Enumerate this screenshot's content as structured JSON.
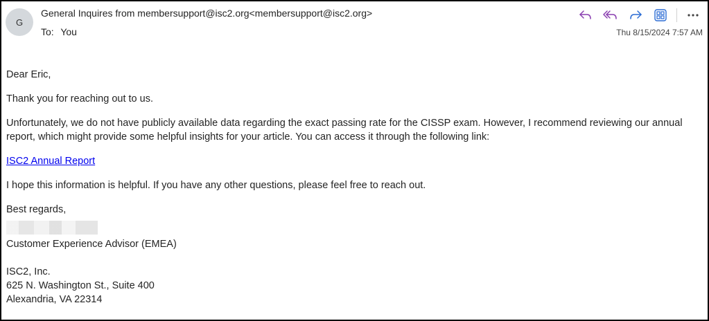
{
  "header": {
    "avatar_initial": "G",
    "from": "General Inquires from membersupport@isc2.org<membersupport@isc2.org>",
    "to_label": "To:",
    "to_value": "You",
    "datetime": "Thu 8/15/2024 7:57 AM"
  },
  "toolbar": {
    "icons": [
      "reply-icon",
      "reply-all-icon",
      "forward-icon",
      "apps-icon",
      "more-options-icon"
    ],
    "accent_color": "#8a3fb0",
    "forward_color": "#2b6cd4"
  },
  "body": {
    "greeting": "Dear Eric,",
    "para1": "Thank you for reaching out to us.",
    "para2": "Unfortunately, we do not have publicly available data regarding the exact passing rate for the CISSP exam. However, I recommend reviewing our annual report, which might provide some helpful insights for your article. You can access it through the following link:",
    "link_text": "ISC2 Annual Report",
    "para3": "I hope this information is helpful. If you have any other questions, please feel free to reach out.",
    "closing": "Best regards,"
  },
  "signature": {
    "title": "Customer Experience Advisor (EMEA)",
    "company": "ISC2, Inc.",
    "address1": "625 N. Washington St., Suite 400",
    "address2": "Alexandria, VA 22314"
  }
}
